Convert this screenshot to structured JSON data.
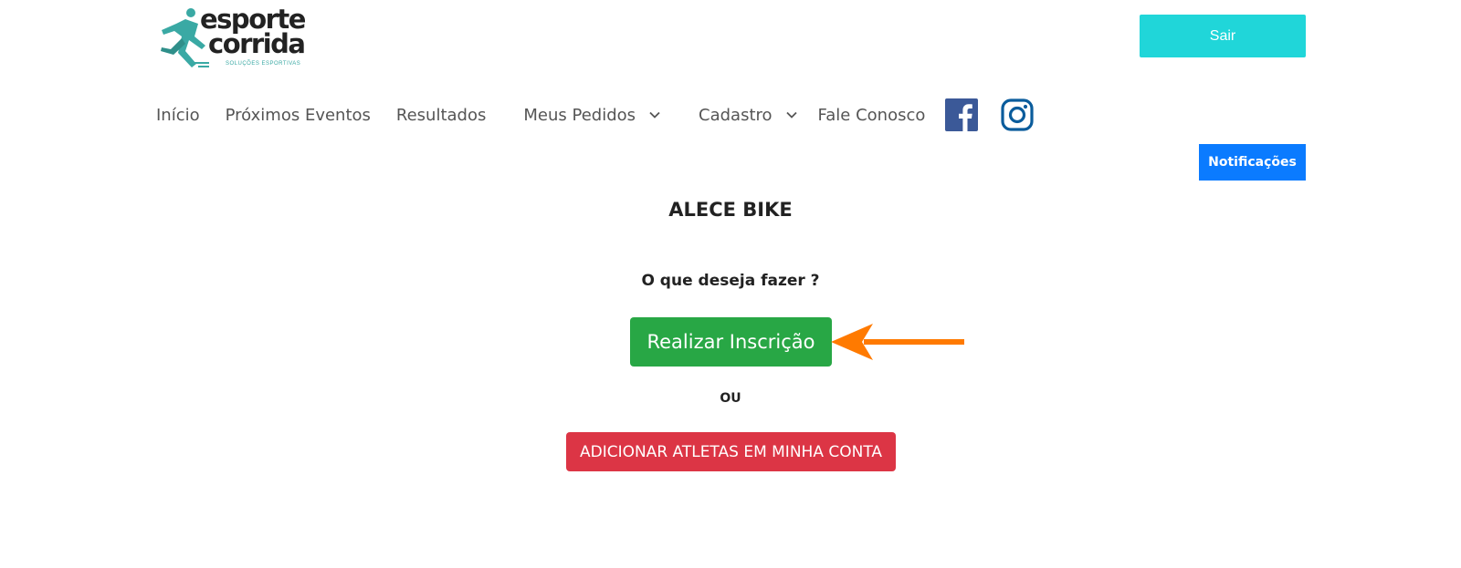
{
  "header": {
    "logo": {
      "line1": "esporte",
      "line2": "corrida",
      "tagline": "SOLUÇÕES ESPORTIVAS"
    },
    "logout_label": "Sair",
    "notifications_label": "Notificações"
  },
  "nav": {
    "items": [
      {
        "label": "Início"
      },
      {
        "label": "Próximos Eventos"
      },
      {
        "label": "Resultados"
      },
      {
        "label": "Meus Pedidos",
        "has_dropdown": true
      },
      {
        "label": "Cadastro",
        "has_dropdown": true
      },
      {
        "label": "Fale Conosco"
      }
    ],
    "social": [
      "facebook-icon",
      "instagram-icon"
    ]
  },
  "main": {
    "event_title": "ALECE BIKE",
    "question": "O que deseja fazer ?",
    "register_label": "Realizar Inscrição",
    "or_label": "OU",
    "add_athletes_label": "ADICIONAR ATLETAS EM MINHA CONTA"
  },
  "colors": {
    "logout_button": "#20d6d9",
    "notifications_button": "#0b7bff",
    "register_button": "#28a745",
    "add_athletes_button": "#dc3545",
    "annotation_arrow": "#ff7a00",
    "facebook": "#3b5998",
    "instagram": "#0a5c9c",
    "logo_accent": "#3aa9a4"
  }
}
